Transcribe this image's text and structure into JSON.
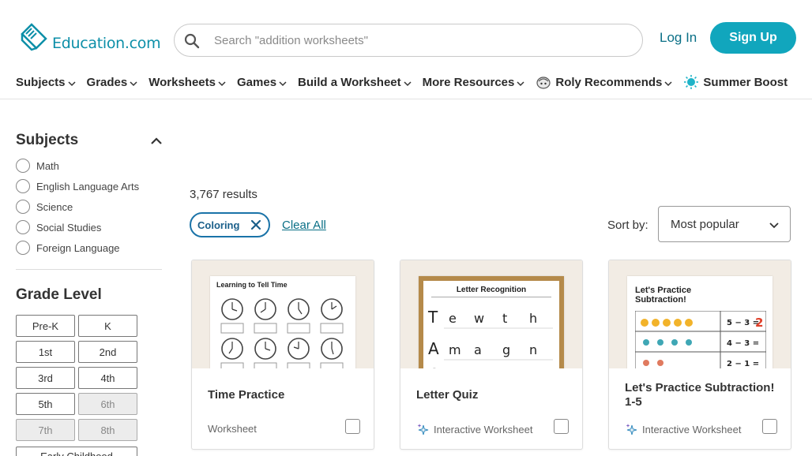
{
  "header": {
    "logo_text": "Education.com",
    "search_placeholder": "Search \"addition worksheets\"",
    "login_label": "Log In",
    "signup_label": "Sign Up"
  },
  "nav": {
    "items": [
      {
        "label": "Subjects"
      },
      {
        "label": "Grades"
      },
      {
        "label": "Worksheets"
      },
      {
        "label": "Games"
      },
      {
        "label": "Build a Worksheet"
      },
      {
        "label": "More Resources"
      },
      {
        "label": "Roly Recommends"
      },
      {
        "label": "Summer Boost"
      }
    ]
  },
  "sidebar": {
    "subjects_title": "Subjects",
    "subjects": [
      "Math",
      "English Language Arts",
      "Science",
      "Social Studies",
      "Foreign Language"
    ],
    "grade_title": "Grade Level",
    "grades": [
      "Pre-K",
      "K",
      "1st",
      "2nd",
      "3rd",
      "4th",
      "5th",
      "6th",
      "7th",
      "8th",
      "Early Childhood"
    ]
  },
  "results": {
    "count_text": "3,767 results",
    "active_filter": "Coloring",
    "clear_all": "Clear All",
    "sort_label": "Sort by:",
    "sort_value": "Most popular"
  },
  "cards": [
    {
      "title": "Time Practice",
      "type": "Worksheet",
      "sheet_heading": "Learning to Tell Time"
    },
    {
      "title": "Letter Quiz",
      "type": "Interactive Worksheet",
      "sheet_heading": "Letter Recognition"
    },
    {
      "title": "Let's Practice Subtraction! 1-5",
      "type": "Interactive Worksheet",
      "sheet_heading": "Let's Practice Subtraction!"
    }
  ],
  "colors": {
    "brand": "#0c8fa8",
    "signup_bg": "#11a6bd",
    "link": "#0a6f86",
    "chip_border": "#1a73a8"
  }
}
